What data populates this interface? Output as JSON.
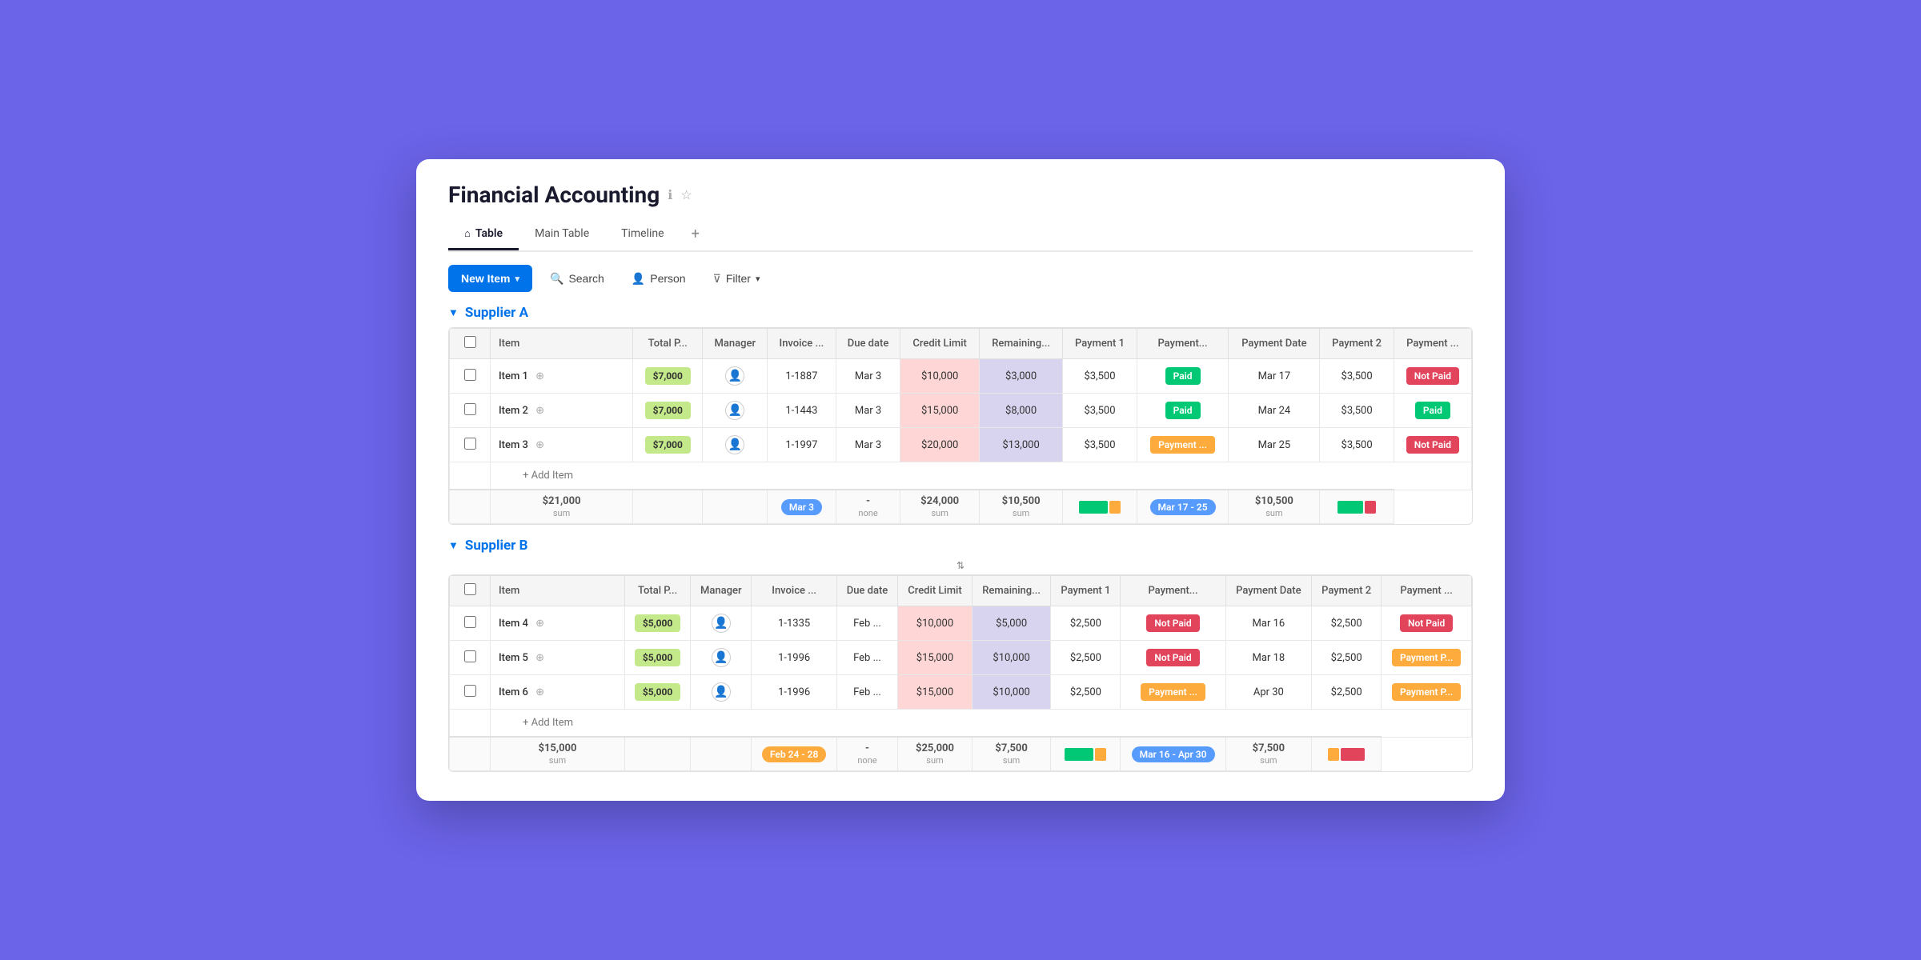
{
  "app": {
    "title": "Financial Accounting",
    "info_icon": "ℹ",
    "star_icon": "☆"
  },
  "tabs": [
    {
      "id": "table",
      "label": "Table",
      "icon": "⌂",
      "active": true
    },
    {
      "id": "main-table",
      "label": "Main Table",
      "active": false
    },
    {
      "id": "timeline",
      "label": "Timeline",
      "active": false
    }
  ],
  "toolbar": {
    "new_item_label": "New Item",
    "search_label": "Search",
    "person_label": "Person",
    "filter_label": "Filter"
  },
  "columns": [
    "Item",
    "Total P...",
    "Manager",
    "Invoice ...",
    "Due date",
    "Credit Limit",
    "Remaining...",
    "Payment 1",
    "Payment...",
    "Payment Date",
    "Payment 2",
    "Payment ..."
  ],
  "supplier_a": {
    "title": "Supplier A",
    "items": [
      {
        "name": "Item 1",
        "total_price": "$7,000",
        "invoice": "1-1887",
        "due_date": "Mar 3",
        "credit_limit": "$10,000",
        "remaining": "$3,000",
        "payment1": "$3,500",
        "payment1_status": "Paid",
        "payment1_status_type": "paid",
        "payment_date": "Mar 17",
        "payment2": "$3,500",
        "payment2_status": "Not Paid",
        "payment2_status_type": "not-paid"
      },
      {
        "name": "Item 2",
        "total_price": "$7,000",
        "invoice": "1-1443",
        "due_date": "Mar 3",
        "credit_limit": "$15,000",
        "remaining": "$8,000",
        "payment1": "$3,500",
        "payment1_status": "Paid",
        "payment1_status_type": "paid",
        "payment_date": "Mar 24",
        "payment2": "$3,500",
        "payment2_status": "Paid",
        "payment2_status_type": "paid"
      },
      {
        "name": "Item 3",
        "total_price": "$7,000",
        "invoice": "1-1997",
        "due_date": "Mar 3",
        "credit_limit": "$20,000",
        "remaining": "$13,000",
        "payment1": "$3,500",
        "payment1_status": "Payment ...",
        "payment1_status_type": "payment-p",
        "payment_date": "Mar 25",
        "payment2": "$3,500",
        "payment2_status": "Not Paid",
        "payment2_status_type": "not-paid"
      }
    ],
    "summary": {
      "total": "$21,000",
      "date": "Mar 3",
      "credit": "$24,000",
      "remaining": "-",
      "payment1": "$10,500",
      "date_range": "Mar 17 - 25",
      "payment2": "$10,500"
    }
  },
  "supplier_b": {
    "title": "Supplier B",
    "items": [
      {
        "name": "Item 4",
        "total_price": "$5,000",
        "invoice": "1-1335",
        "due_date": "Feb ...",
        "credit_limit": "$10,000",
        "remaining": "$5,000",
        "payment1": "$2,500",
        "payment1_status": "Not Paid",
        "payment1_status_type": "not-paid",
        "payment_date": "Mar 16",
        "payment2": "$2,500",
        "payment2_status": "Not Paid",
        "payment2_status_type": "not-paid"
      },
      {
        "name": "Item 5",
        "total_price": "$5,000",
        "invoice": "1-1996",
        "due_date": "Feb ...",
        "credit_limit": "$15,000",
        "remaining": "$10,000",
        "payment1": "$2,500",
        "payment1_status": "Not Paid",
        "payment1_status_type": "not-paid",
        "payment_date": "Mar 18",
        "payment2": "$2,500",
        "payment2_status": "Payment P...",
        "payment2_status_type": "payment-p"
      },
      {
        "name": "Item 6",
        "total_price": "$5,000",
        "invoice": "1-1996",
        "due_date": "Feb ...",
        "credit_limit": "$15,000",
        "remaining": "$10,000",
        "payment1": "$2,500",
        "payment1_status": "Payment ...",
        "payment1_status_type": "payment-p",
        "payment_date": "Apr 30",
        "payment2": "$2,500",
        "payment2_status": "Payment P...",
        "payment2_status_type": "payment-p"
      }
    ],
    "summary": {
      "total": "$15,000",
      "date": "Feb 24 - 28",
      "credit": "$25,000",
      "remaining": "-",
      "payment1": "$7,500",
      "date_range": "Mar 16 - Apr 30",
      "payment2": "$7,500"
    }
  },
  "add_item_label": "+ Add Item",
  "sum_label": "sum",
  "none_label": "none"
}
